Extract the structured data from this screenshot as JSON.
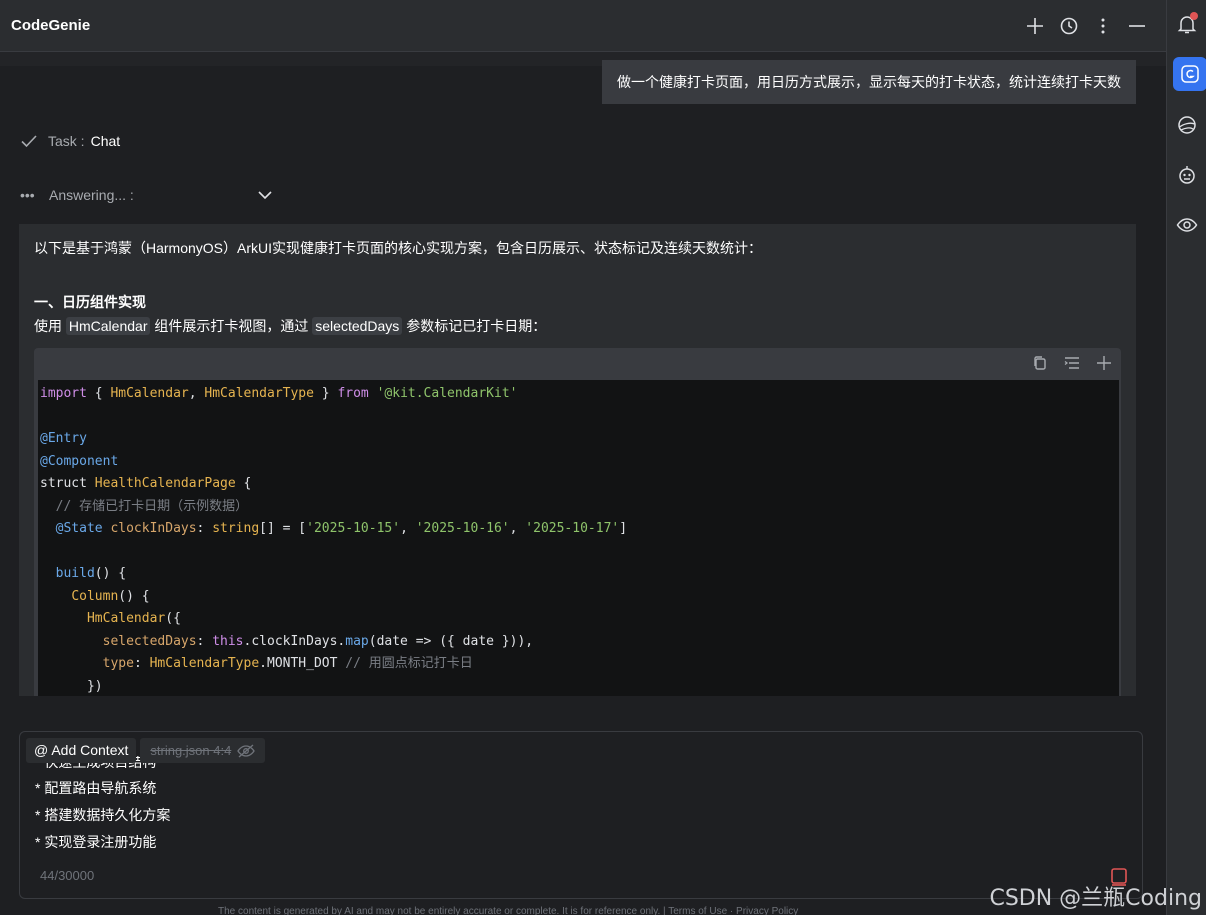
{
  "header": {
    "title": "CodeGenie"
  },
  "user_message": "做一个健康打卡页面，用日历方式展示，显示每天的打卡状态，统计连续打卡天数",
  "task": {
    "label": "Task :",
    "value": "Chat"
  },
  "status": {
    "label": "Answering... :"
  },
  "answer": {
    "intro": "以下是基于鸿蒙（HarmonyOS）ArkUI实现健康打卡页面的核心实现方案，包含日历展示、状态标记及连续天数统计：",
    "section_title": "一、日历组件实现",
    "desc_pre": "使用 ",
    "desc_chip1": "HmCalendar",
    "desc_mid": " 组件展示打卡视图，通过 ",
    "desc_chip2": "selectedDays",
    "desc_post": " 参数标记已打卡日期："
  },
  "code": {
    "l1_a": "import",
    "l1_b": " { ",
    "l1_c": "HmCalendar",
    "l1_d": ", ",
    "l1_e": "HmCalendarType",
    "l1_f": " } ",
    "l1_g": "from",
    "l1_h": " ",
    "l1_i": "'@kit.CalendarKit'",
    "l3": "@Entry",
    "l4": "@Component",
    "l5_a": "struct ",
    "l5_b": "HealthCalendarPage",
    "l5_c": " {",
    "l6": "  // 存储已打卡日期（示例数据）",
    "l7_a": "  ",
    "l7_b": "@State",
    "l7_c": " ",
    "l7_d": "clockInDays",
    "l7_e": ": ",
    "l7_f": "string",
    "l7_g": "[] = [",
    "l7_h": "'2025-10-15'",
    "l7_i": ", ",
    "l7_j": "'2025-10-16'",
    "l7_k": ", ",
    "l7_l": "'2025-10-17'",
    "l7_m": "]",
    "l9_a": "  ",
    "l9_b": "build",
    "l9_c": "() {",
    "l10_a": "    ",
    "l10_b": "Column",
    "l10_c": "() {",
    "l11_a": "      ",
    "l11_b": "HmCalendar",
    "l11_c": "({",
    "l12_a": "        ",
    "l12_b": "selectedDays",
    "l12_c": ": ",
    "l12_d": "this",
    "l12_e": ".clockInDays.",
    "l12_f": "map",
    "l12_g": "(date => ({ date })),",
    "l13_a": "        ",
    "l13_b": "type",
    "l13_c": ": ",
    "l13_d": "HmCalendarType",
    "l13_e": ".MONTH_DOT ",
    "l13_f": "// 用圆点标记打卡日",
    "l14": "      })"
  },
  "input": {
    "add_context": "@ Add Context",
    "file_chip": "string.json  4:4",
    "line0": "* 快速生成项目结构",
    "line1": "* 配置路由导航系统",
    "line2": "* 搭建数据持久化方案",
    "line3": "* 实现登录注册功能",
    "counter": "44/30000"
  },
  "disclaimer": "The content is generated by AI and may not be entirely accurate or complete. It is for reference only.  |   Terms of Use · Privacy Policy",
  "watermark": "CSDN @兰瓶Coding",
  "colors": {
    "accent": "#3574f0",
    "background": "#1e1f22",
    "panel": "#2b2d30"
  }
}
